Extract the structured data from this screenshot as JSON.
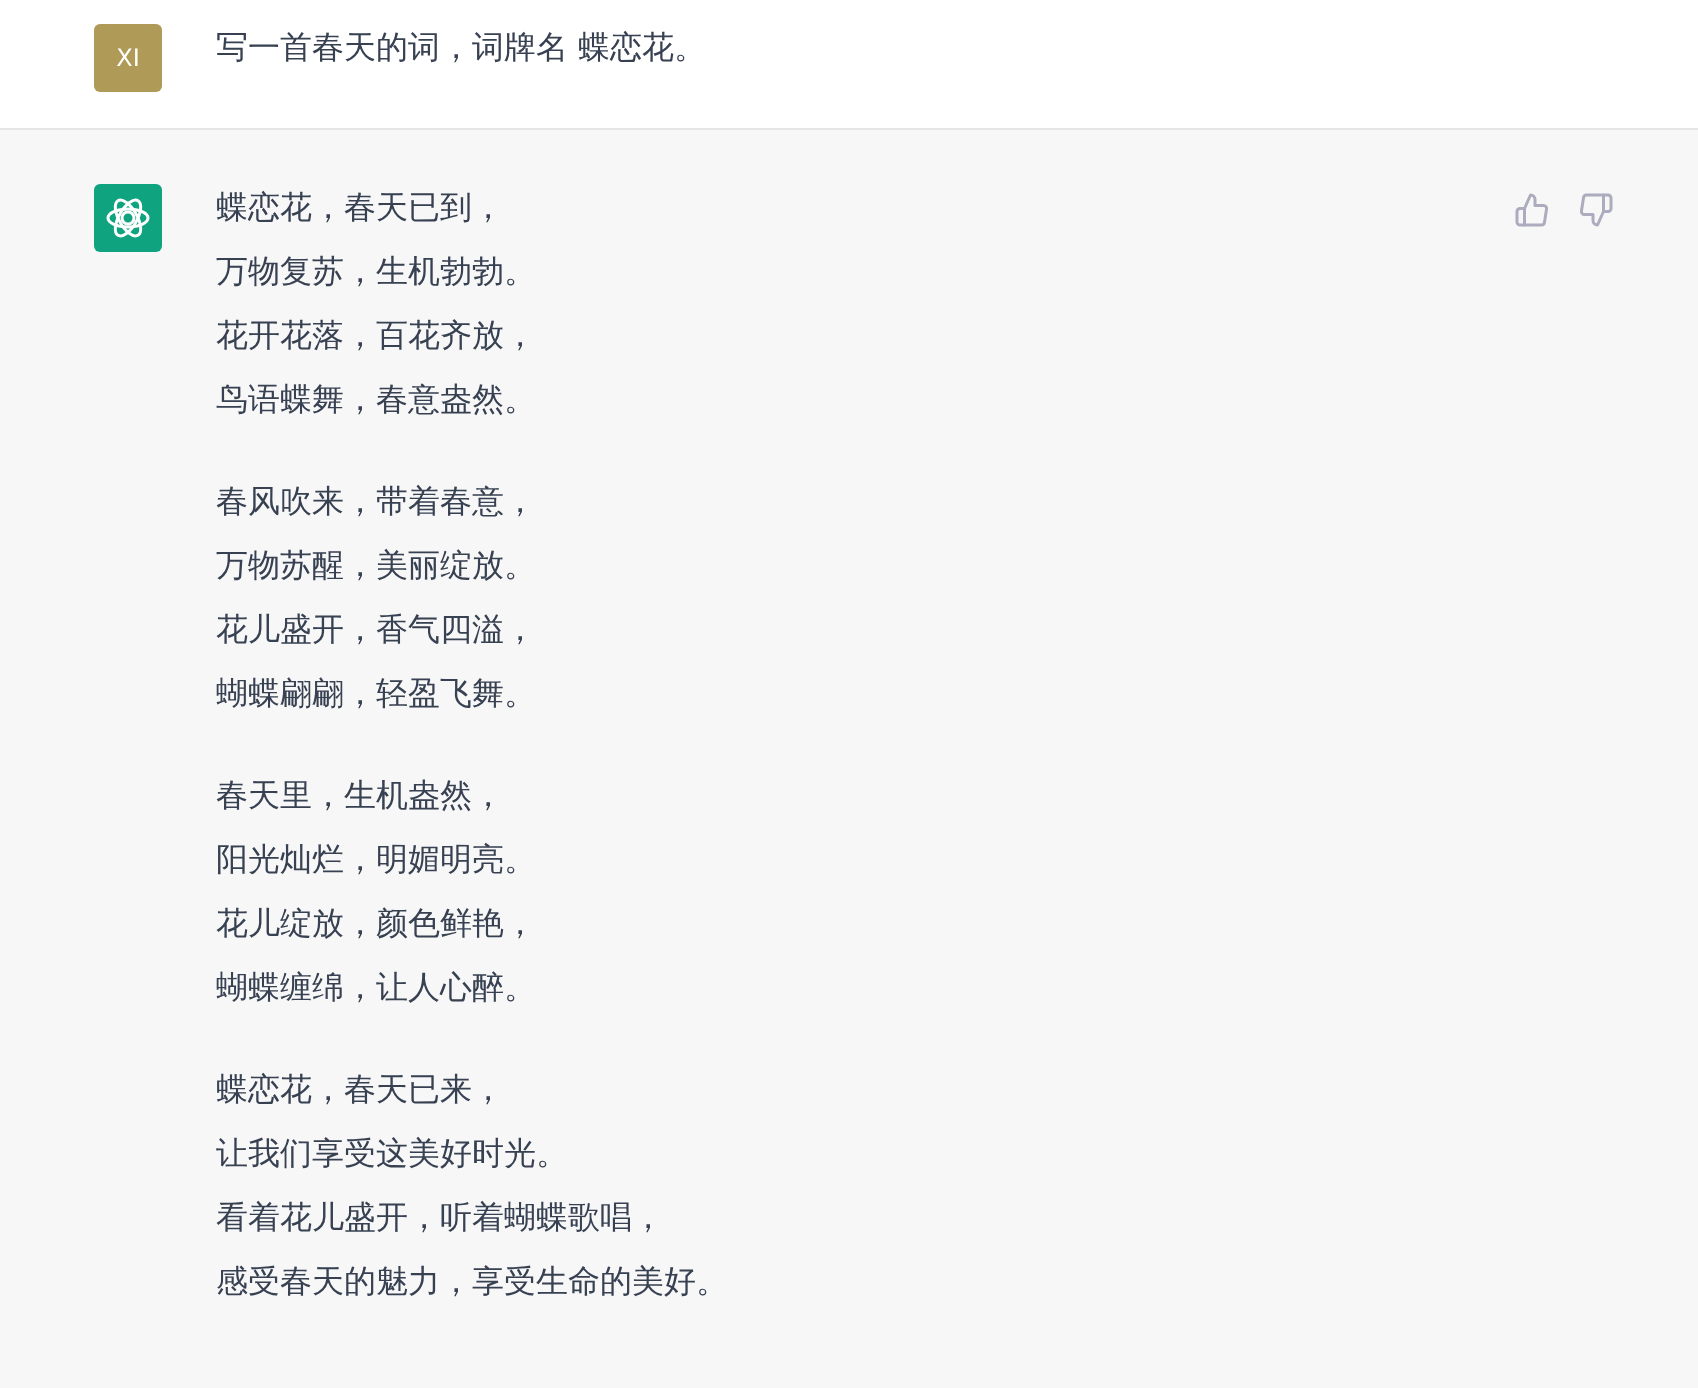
{
  "messages": [
    {
      "kind": "user",
      "avatar": "XI",
      "paragraphs": [
        [
          "写一首春天的词，词牌名 蝶恋花。"
        ]
      ]
    },
    {
      "kind": "assistant",
      "paragraphs": [
        [
          "蝶恋花，春天已到，",
          "万物复苏，生机勃勃。",
          "花开花落，百花齐放，",
          "鸟语蝶舞，春意盎然。"
        ],
        [
          "春风吹来，带着春意，",
          "万物苏醒，美丽绽放。",
          "花儿盛开，香气四溢，",
          "蝴蝶翩翩，轻盈飞舞。"
        ],
        [
          "春天里，生机盎然，",
          "阳光灿烂，明媚明亮。",
          "花儿绽放，颜色鲜艳，",
          "蝴蝶缠绵，让人心醉。"
        ],
        [
          "蝶恋花，春天已来，",
          "让我们享受这美好时光。",
          "看着花儿盛开，听着蝴蝶歌唱，",
          "感受春天的魅力，享受生命的美好。"
        ]
      ]
    }
  ]
}
